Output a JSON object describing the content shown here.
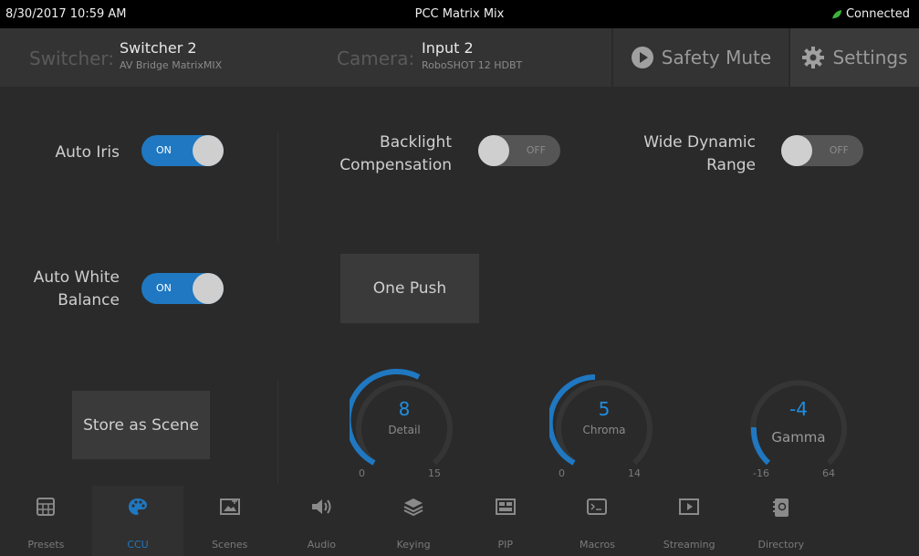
{
  "titlebar": {
    "datetime": "8/30/2017 10:59 AM",
    "title": "PCC Matrix Mix",
    "status": "Connected",
    "status_color": "#3db33d"
  },
  "header": {
    "switcher_label": "Switcher:",
    "switcher_name": "Switcher 2",
    "switcher_device": "AV Bridge MatrixMIX",
    "camera_label": "Camera:",
    "camera_name": "Input 2",
    "camera_device": "RoboSHOT 12 HDBT",
    "safety_mute_label": "Safety Mute",
    "settings_label": "Settings"
  },
  "controls": {
    "auto_iris": {
      "label": "Auto Iris",
      "state": "ON"
    },
    "backlight": {
      "label_line1": "Backlight",
      "label_line2": "Compensation",
      "state": "OFF"
    },
    "wdr": {
      "label_line1": "Wide Dynamic",
      "label_line2": "Range",
      "state": "OFF"
    },
    "awb": {
      "label_line1": "Auto White",
      "label_line2": "Balance",
      "state": "ON"
    },
    "one_push_label": "One Push",
    "store_scene_label": "Store as Scene"
  },
  "dials": {
    "detail": {
      "name": "Detail",
      "value": "8",
      "min": "0",
      "max": "15"
    },
    "chroma": {
      "name": "Chroma",
      "value": "5",
      "min": "0",
      "max": "14"
    },
    "gamma": {
      "name": "Gamma",
      "value": "-4",
      "min": "-16",
      "max": "64"
    }
  },
  "colors": {
    "accent": "#1f78c1",
    "background": "#2a2a2a"
  },
  "nav": {
    "items": [
      {
        "label": "Presets",
        "icon": "grid-icon"
      },
      {
        "label": "CCU",
        "icon": "palette-icon",
        "active": true
      },
      {
        "label": "Scenes",
        "icon": "image-icon"
      },
      {
        "label": "Audio",
        "icon": "speaker-icon"
      },
      {
        "label": "Keying",
        "icon": "layers-icon"
      },
      {
        "label": "PIP",
        "icon": "pip-icon"
      },
      {
        "label": "Macros",
        "icon": "terminal-icon"
      },
      {
        "label": "Streaming",
        "icon": "play-icon"
      },
      {
        "label": "Directory",
        "icon": "address-book-icon"
      }
    ]
  }
}
